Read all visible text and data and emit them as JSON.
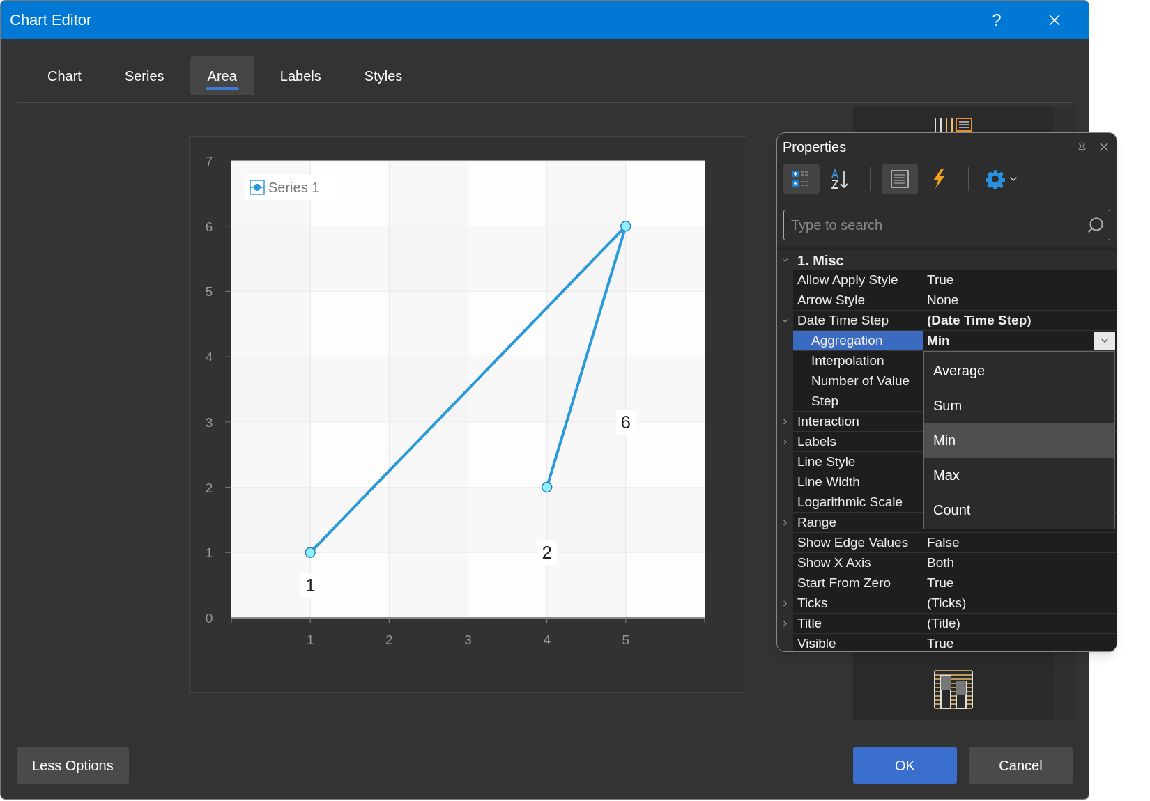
{
  "window": {
    "title": "Chart Editor",
    "help": "?"
  },
  "tabs": [
    {
      "label": "Chart",
      "selected": false
    },
    {
      "label": "Series",
      "selected": false
    },
    {
      "label": "Area",
      "selected": true
    },
    {
      "label": "Labels",
      "selected": false
    },
    {
      "label": "Styles",
      "selected": false
    }
  ],
  "chart": {
    "chart_data": {
      "type": "line",
      "x": [
        1,
        5,
        4
      ],
      "series": [
        {
          "name": "Series 1",
          "color": "#2b9ad8",
          "marker": "circle",
          "values": [
            1,
            6,
            2
          ]
        }
      ],
      "xlim": [
        0,
        6
      ],
      "ylim": [
        0,
        7
      ],
      "xticks": [
        1,
        2,
        3,
        4,
        5
      ],
      "yticks": [
        0,
        1,
        2,
        3,
        4,
        5,
        6,
        7
      ],
      "grid": true,
      "annotations": [
        {
          "x": 1,
          "y": 0.5,
          "text": "1"
        },
        {
          "x": 5,
          "y": 3,
          "text": "6"
        },
        {
          "x": 4,
          "y": 1,
          "text": "2"
        }
      ]
    }
  },
  "properties": {
    "title": "Properties",
    "toolbar": [
      {
        "kind": "categorized",
        "selected": true
      },
      {
        "kind": "alphabetical",
        "selected": false
      },
      {
        "kind": "properties",
        "selected": true
      },
      {
        "kind": "events",
        "selected": false
      },
      {
        "kind": "settings",
        "selected": false
      }
    ],
    "search": {
      "placeholder": "Type to search"
    },
    "category": {
      "label": "1. Misc",
      "expanded": true
    },
    "rows": [
      {
        "name": "Allow Apply Style",
        "value": "True",
        "bold": false,
        "selected": false
      },
      {
        "name": "Arrow Style",
        "value": "None",
        "bold": false,
        "selected": false
      },
      {
        "name": "Date Time Step",
        "value": "(Date Time Step)",
        "expanded": true,
        "bold": true,
        "selected": false,
        "children": [
          {
            "name": "Aggregation",
            "value": "Min",
            "bold": true,
            "selected": true,
            "dropdown_open": true,
            "options": [
              {
                "label": "Average",
                "selected": false
              },
              {
                "label": "Sum",
                "selected": false
              },
              {
                "label": "Min",
                "selected": true
              },
              {
                "label": "Max",
                "selected": false
              },
              {
                "label": "Count",
                "selected": false
              }
            ]
          },
          {
            "name": "Interpolation",
            "selected": false
          },
          {
            "name": "Number of Value",
            "selected": false
          },
          {
            "name": "Step",
            "selected": false
          }
        ]
      },
      {
        "name": "Interaction",
        "expanded": false,
        "selected": false
      },
      {
        "name": "Labels",
        "expanded": false,
        "selected": false
      },
      {
        "name": "Line Style",
        "selected": false
      },
      {
        "name": "Line Width",
        "selected": false
      },
      {
        "name": "Logarithmic Scale",
        "selected": false
      },
      {
        "name": "Range",
        "expanded": false,
        "selected": false
      },
      {
        "name": "Show Edge Values",
        "value": "False",
        "bold": false,
        "selected": false
      },
      {
        "name": "Show X Axis",
        "value": "Both",
        "bold": false,
        "selected": false
      },
      {
        "name": "Start From Zero",
        "value": "True",
        "bold": false,
        "selected": false
      },
      {
        "name": "Ticks",
        "value": "(Ticks)",
        "expanded": false,
        "bold": false,
        "selected": false
      },
      {
        "name": "Title",
        "value": "(Title)",
        "expanded": false,
        "bold": false,
        "selected": false
      },
      {
        "name": "Visible",
        "value": "True",
        "bold": false,
        "selected": false
      }
    ]
  },
  "buttons": [
    {
      "label": "Less Options",
      "kind": "secondary"
    },
    {
      "label": "OK",
      "kind": "primary"
    },
    {
      "label": "Cancel",
      "kind": "secondary"
    }
  ]
}
